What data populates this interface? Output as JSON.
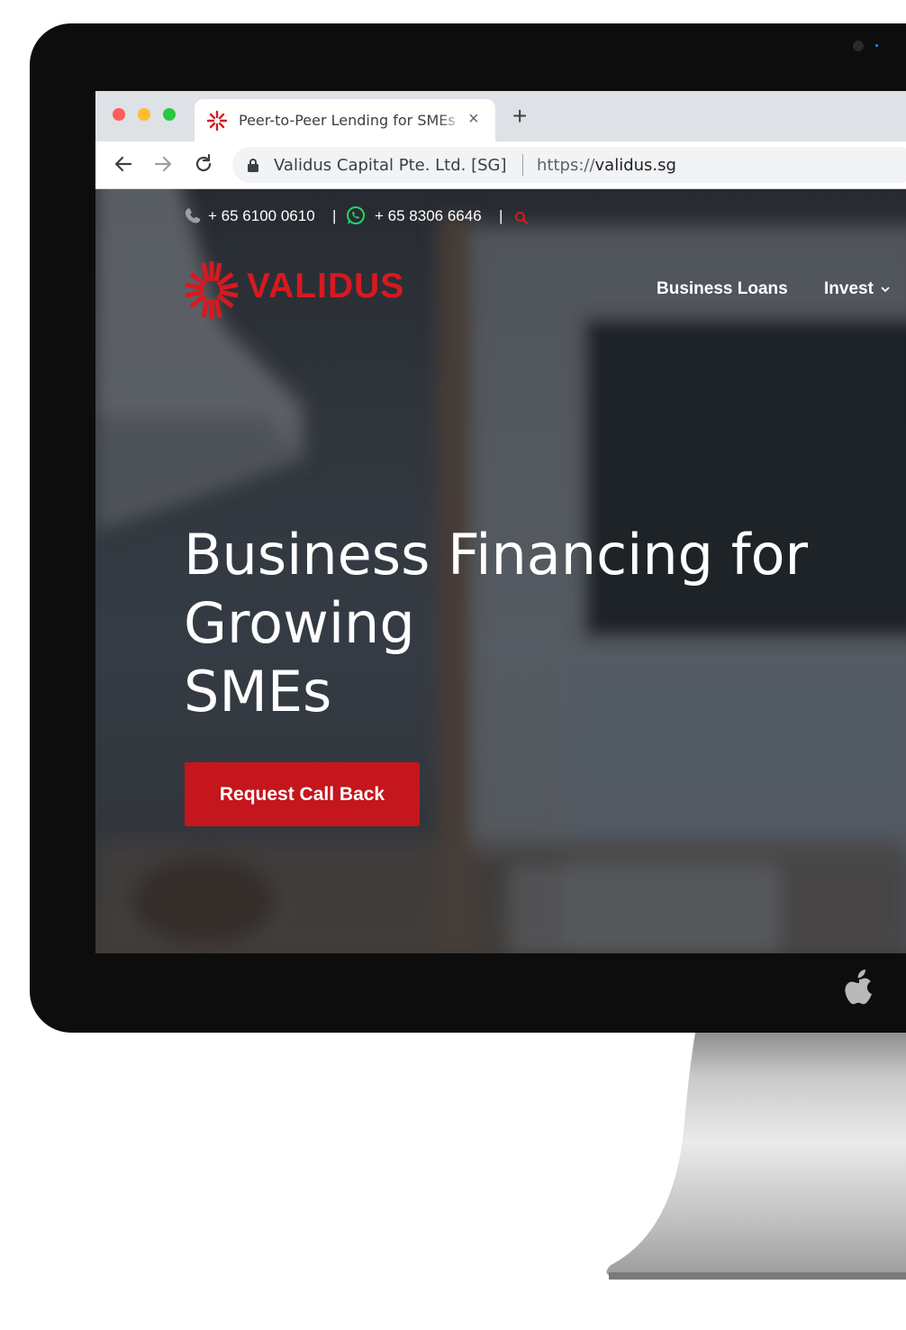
{
  "browser": {
    "tab_title": "Peer-to-Peer Lending for SMEs",
    "tab_close": "×",
    "new_tab": "+",
    "site_identity": "Validus Capital Pte. Ltd. [SG]",
    "url_scheme": "https://",
    "url_host": "validus.sg",
    "traffic_lights": [
      "#ff5f57",
      "#febc2e",
      "#28c840"
    ]
  },
  "site": {
    "phone": "+ 65 6100 0610",
    "divider": "|",
    "whatsapp": "+ 65 8306 6646",
    "logo_text": "VALIDUS",
    "nav": [
      {
        "label": "Business Loans"
      },
      {
        "label": "Invest"
      }
    ],
    "headline": "Business Financing for Growing\nSMEs",
    "cta_label": "Request Call Back",
    "brand_color": "#d71920",
    "whatsapp_color": "#25d366"
  }
}
